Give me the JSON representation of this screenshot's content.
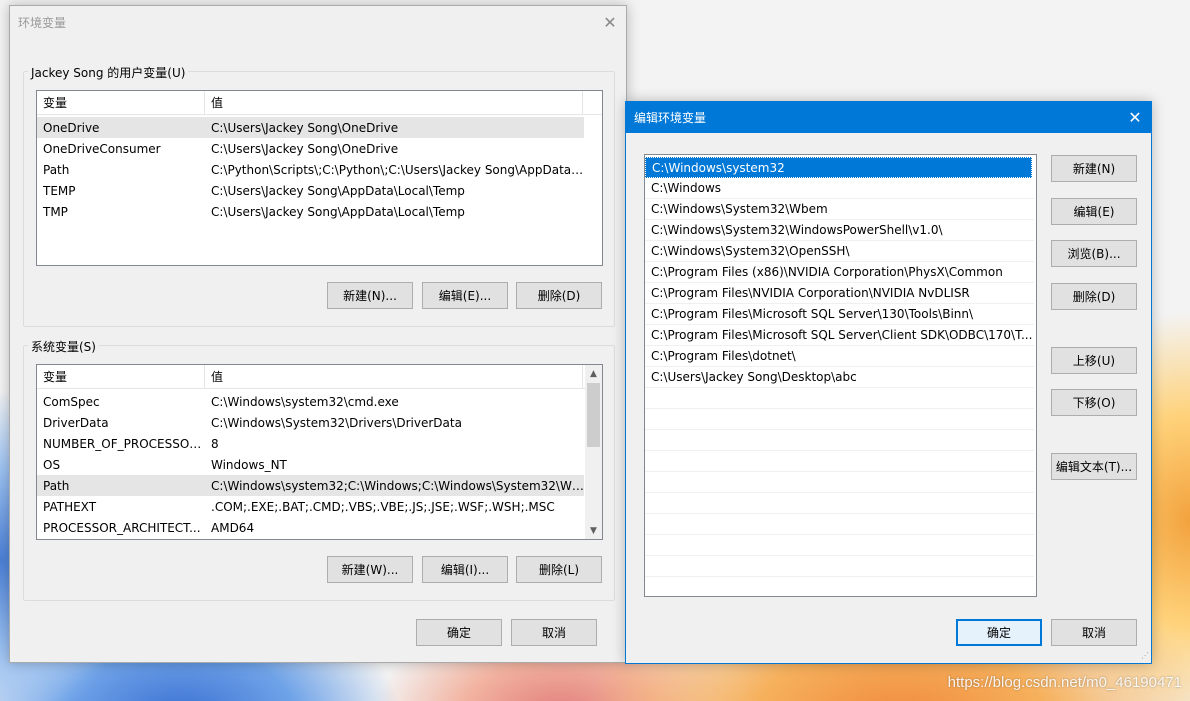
{
  "env_dialog": {
    "title": "环境变量",
    "user_group_label": "Jackey Song 的用户变量(U)",
    "user_columns": [
      "变量",
      "值"
    ],
    "user_vars": [
      {
        "name": "OneDrive",
        "value": "C:\\Users\\Jackey Song\\OneDrive",
        "selected": true
      },
      {
        "name": "OneDriveConsumer",
        "value": "C:\\Users\\Jackey Song\\OneDrive"
      },
      {
        "name": "Path",
        "value": "C:\\Python\\Scripts\\;C:\\Python\\;C:\\Users\\Jackey Song\\AppData\\..."
      },
      {
        "name": "TEMP",
        "value": "C:\\Users\\Jackey Song\\AppData\\Local\\Temp"
      },
      {
        "name": "TMP",
        "value": "C:\\Users\\Jackey Song\\AppData\\Local\\Temp"
      }
    ],
    "user_buttons": {
      "new": "新建(N)...",
      "edit": "编辑(E)...",
      "delete": "删除(D)"
    },
    "system_group_label": "系统变量(S)",
    "system_columns": [
      "变量",
      "值"
    ],
    "system_vars": [
      {
        "name": "ComSpec",
        "value": "C:\\Windows\\system32\\cmd.exe"
      },
      {
        "name": "DriverData",
        "value": "C:\\Windows\\System32\\Drivers\\DriverData"
      },
      {
        "name": "NUMBER_OF_PROCESSORS",
        "value": "8"
      },
      {
        "name": "OS",
        "value": "Windows_NT"
      },
      {
        "name": "Path",
        "value": "C:\\Windows\\system32;C:\\Windows;C:\\Windows\\System32\\Wb...",
        "selected": true
      },
      {
        "name": "PATHEXT",
        "value": ".COM;.EXE;.BAT;.CMD;.VBS;.VBE;.JS;.JSE;.WSF;.WSH;.MSC"
      },
      {
        "name": "PROCESSOR_ARCHITECT...",
        "value": "AMD64"
      }
    ],
    "system_buttons": {
      "new": "新建(W)...",
      "edit": "编辑(I)...",
      "delete": "删除(L)"
    },
    "ok": "确定",
    "cancel": "取消"
  },
  "edit_dialog": {
    "title": "编辑环境变量",
    "paths": [
      "C:\\Windows\\system32",
      "C:\\Windows",
      "C:\\Windows\\System32\\Wbem",
      "C:\\Windows\\System32\\WindowsPowerShell\\v1.0\\",
      "C:\\Windows\\System32\\OpenSSH\\",
      "C:\\Program Files (x86)\\NVIDIA Corporation\\PhysX\\Common",
      "C:\\Program Files\\NVIDIA Corporation\\NVIDIA NvDLISR",
      "C:\\Program Files\\Microsoft SQL Server\\130\\Tools\\Binn\\",
      "C:\\Program Files\\Microsoft SQL Server\\Client SDK\\ODBC\\170\\T...",
      "C:\\Program Files\\dotnet\\",
      "C:\\Users\\Jackey Song\\Desktop\\abc"
    ],
    "buttons": {
      "new": "新建(N)",
      "edit": "编辑(E)",
      "browse": "浏览(B)...",
      "delete": "删除(D)",
      "up": "上移(U)",
      "down": "下移(O)",
      "edit_text": "编辑文本(T)..."
    },
    "ok": "确定",
    "cancel": "取消",
    "accent": "#0078d7"
  },
  "watermark": "https://blog.csdn.net/m0_46190471"
}
